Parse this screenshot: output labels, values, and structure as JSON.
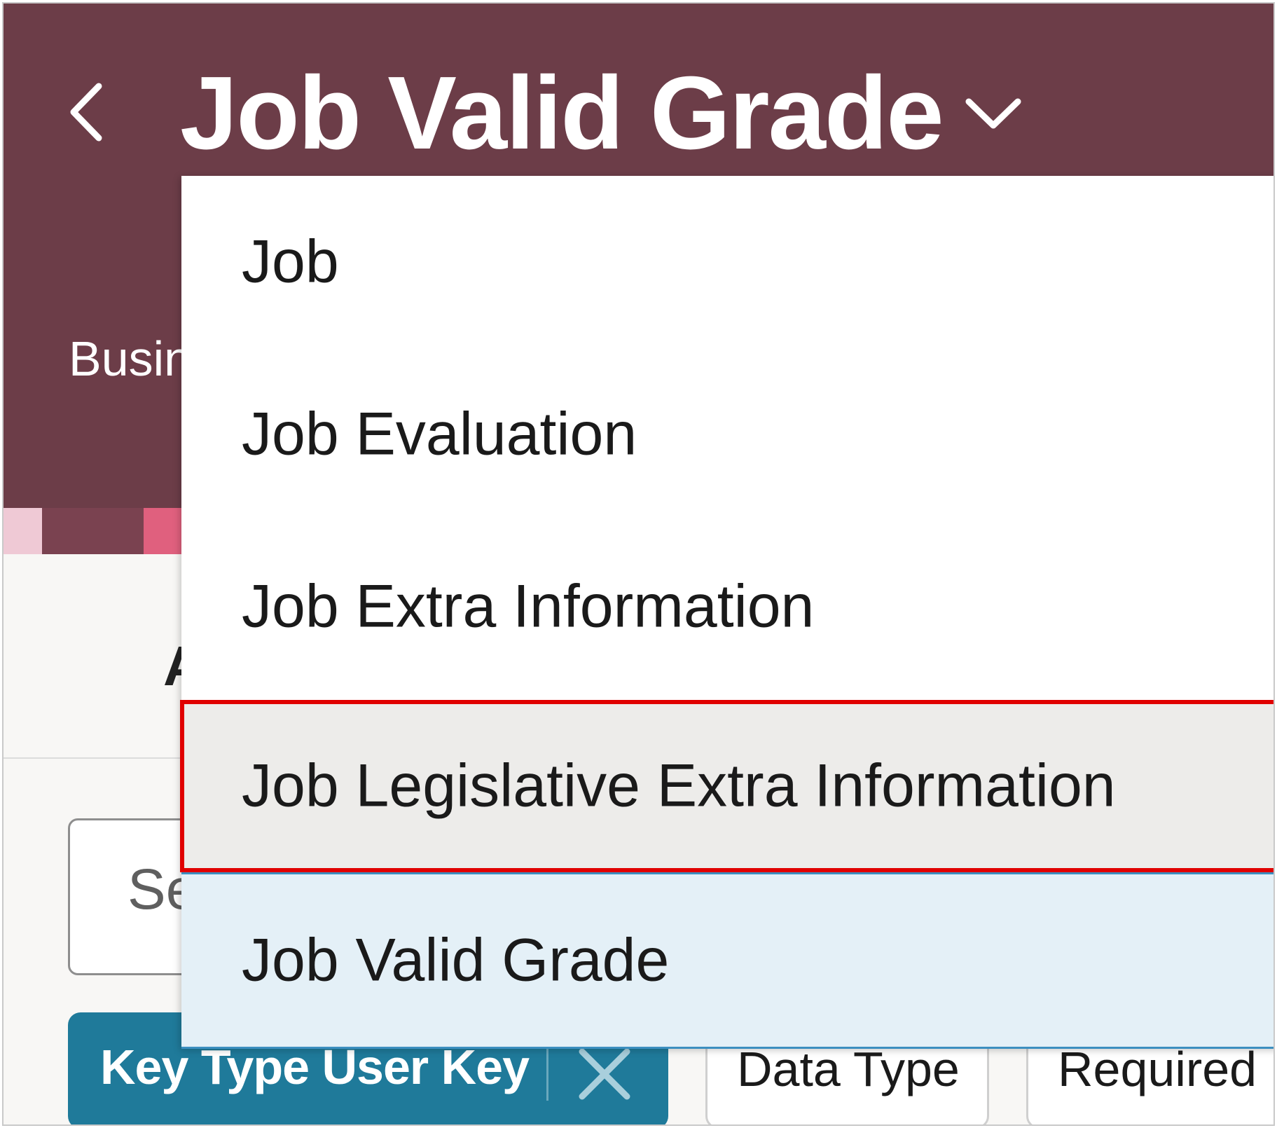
{
  "header": {
    "title": "Job Valid Grade",
    "subtitle_partial": "Busin"
  },
  "content": {
    "heading_partial": "A",
    "search_placeholder_partial": "Se"
  },
  "dropdown": {
    "options": [
      {
        "label": "Job"
      },
      {
        "label": "Job Evaluation"
      },
      {
        "label": "Job Extra Information"
      },
      {
        "label": "Job Legislative Extra Information",
        "state": "hovered"
      },
      {
        "label": "Job Valid Grade",
        "state": "selected"
      }
    ]
  },
  "filters": {
    "active_chip": "Key Type User Key",
    "chips": [
      "Data Type",
      "Required"
    ]
  },
  "colors": {
    "header_bg": "#6c3d48",
    "chip_active_bg": "#1f7a9a",
    "selected_bg": "#e4f0f7",
    "hover_bg": "#edecea",
    "highlight_border": "#e00000"
  }
}
